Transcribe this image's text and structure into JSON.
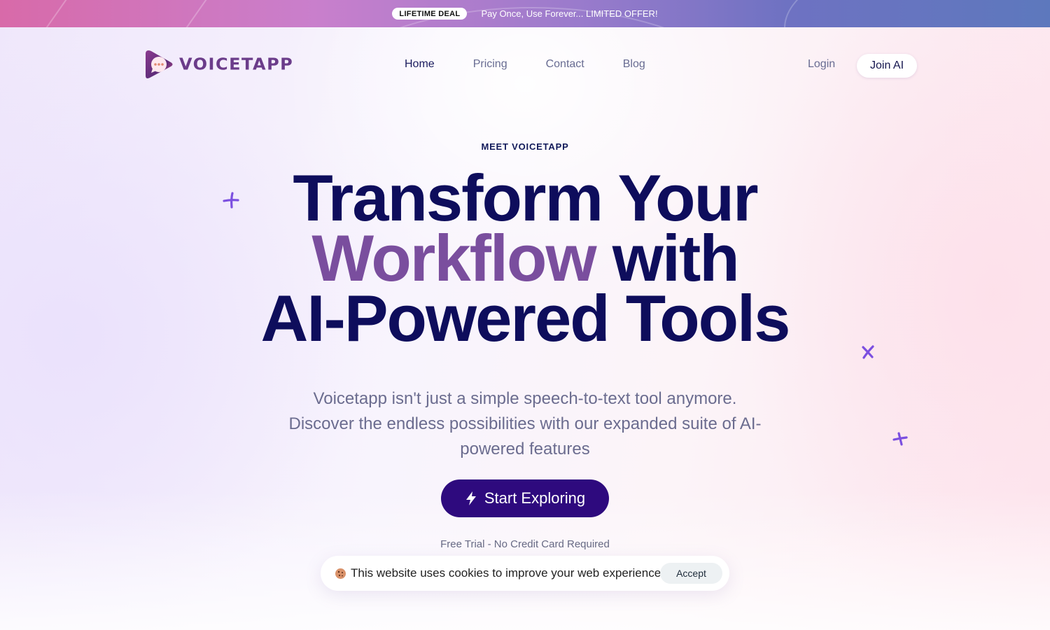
{
  "promo_banner": {
    "badge": "LIFETIME DEAL",
    "text": "Pay Once, Use Forever... LIMITED OFFER!"
  },
  "header": {
    "logo_text": "VOICETAPP",
    "logo_icon": "chat-bubble-play-icon",
    "nav": [
      {
        "label": "Home",
        "active": true
      },
      {
        "label": "Pricing",
        "active": false
      },
      {
        "label": "Contact",
        "active": false
      },
      {
        "label": "Blog",
        "active": false
      }
    ],
    "login_label": "Login",
    "join_label": "Join AI"
  },
  "hero": {
    "eyebrow": "MEET VOICETAPP",
    "headline": {
      "line1": "Transform Your",
      "line2_accent": "Workflow",
      "line2_rest": " with",
      "line3": "AI-Powered Tools"
    },
    "subtitle": "Voicetapp isn't just a simple speech-to-text tool anymore. Discover the endless possibilities with our expanded suite of AI-powered features",
    "cta_label": "Start Exploring",
    "cta_icon": "lightning-bolt-icon",
    "note": "Free Trial - No Credit Card Required"
  },
  "cookie_banner": {
    "icon": "cookie-icon",
    "text": "This website uses cookies to improve your web experience.",
    "accept_label": "Accept"
  },
  "colors": {
    "headline": "#0e0d5c",
    "accent": "#7a4e9e",
    "cta_background": "#2e0a7e",
    "sparkle": "#7b4fe0",
    "nav_text": "#686c92",
    "nav_active": "#1a1b5e"
  }
}
